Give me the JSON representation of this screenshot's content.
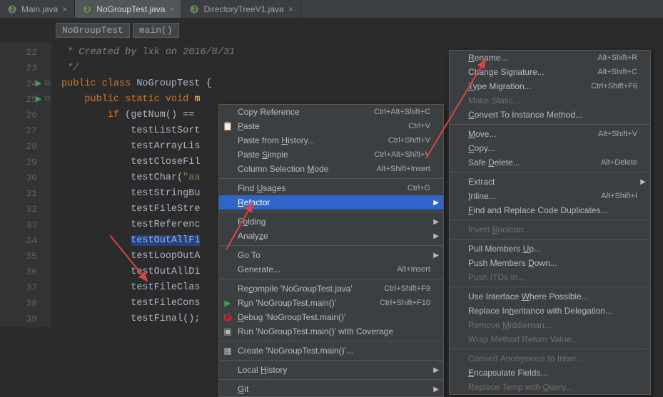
{
  "tabs": [
    {
      "label": "Main.java",
      "active": false
    },
    {
      "label": "NoGroupTest.java",
      "active": true
    },
    {
      "label": "DirectoryTreeV1.java",
      "active": false
    }
  ],
  "breadcrumbs": [
    {
      "label": "NoGroupTest"
    },
    {
      "label": "main()"
    }
  ],
  "lines": [
    {
      "num": 22,
      "run": false
    },
    {
      "num": 23,
      "run": false
    },
    {
      "num": 24,
      "run": true
    },
    {
      "num": 25,
      "run": true
    },
    {
      "num": 26,
      "run": false
    },
    {
      "num": 27,
      "run": false
    },
    {
      "num": 28,
      "run": false
    },
    {
      "num": 29,
      "run": false
    },
    {
      "num": 30,
      "run": false
    },
    {
      "num": 31,
      "run": false
    },
    {
      "num": 32,
      "run": false
    },
    {
      "num": 33,
      "run": false
    },
    {
      "num": 34,
      "run": false
    },
    {
      "num": 35,
      "run": false
    },
    {
      "num": 36,
      "run": false
    },
    {
      "num": 37,
      "run": false
    },
    {
      "num": 38,
      "run": false
    },
    {
      "num": 39,
      "run": false
    }
  ],
  "code": {
    "l22_pre": " * Created by lxk on 2016/8/31",
    "l23_pre": " */",
    "l24_kw1": "public class ",
    "l24_cls": "NoGroupTest ",
    "l24_brace": "{",
    "l25_kw1": "public static void ",
    "l25_mth": "m",
    "l26_kw1": "if ",
    "l26_p": "(",
    "l26_call": "getNum",
    "l26_p2": "() == ",
    "l27": "testListSort",
    "l28": "testArrayLis",
    "l29": "testCloseFil",
    "l30a": "testChar",
    "l30b": "(",
    "l30c": "\"aa",
    "l31": "testStringBu",
    "l32": "testFileStre",
    "l33": "testReferenc",
    "l34": "testOutAllFi",
    "l35": "testLoopOutA",
    "l36": "testOutAllDi",
    "l37": "testFileClas",
    "l38": "testFileCons",
    "l39a": "testFinal",
    "l39b": "();"
  },
  "context_menu": [
    {
      "label": "Copy Reference",
      "shortcut": "Ctrl+Alt+Shift+C"
    },
    {
      "label": "Paste",
      "mnem": "P",
      "shortcut": "Ctrl+V",
      "icon": "paste"
    },
    {
      "label": "Paste from History...",
      "mnem": "H",
      "shortcut": "Ctrl+Shift+V"
    },
    {
      "label": "Paste Simple",
      "mnem": "S",
      "shortcut": "Ctrl+Alt+Shift+V"
    },
    {
      "label": "Column Selection Mode",
      "mnem": "M",
      "shortcut": "Alt+Shift+Insert"
    },
    {
      "sep": true
    },
    {
      "label": "Find Usages",
      "mnem": "U",
      "shortcut": "Ctrl+G"
    },
    {
      "label": "Refactor",
      "mnem": "R",
      "sub": true,
      "hl": true
    },
    {
      "sep": true
    },
    {
      "label": "Folding",
      "mnem": "o",
      "sub": true
    },
    {
      "label": "Analyze",
      "mnem": "z",
      "sub": true
    },
    {
      "sep": true
    },
    {
      "label": "Go To",
      "sub": true
    },
    {
      "label": "Generate...",
      "shortcut": "Alt+Insert"
    },
    {
      "sep": true
    },
    {
      "label": "Recompile 'NoGroupTest.java'",
      "mnem": "c",
      "shortcut": "Ctrl+Shift+F9"
    },
    {
      "label": "Run 'NoGroupTest.main()'",
      "mnem": "u",
      "shortcut": "Ctrl+Shift+F10",
      "icon": "run"
    },
    {
      "label": "Debug 'NoGroupTest.main()'",
      "mnem": "D",
      "icon": "debug"
    },
    {
      "label": "Run 'NoGroupTest.main()' with Coverage",
      "icon": "coverage"
    },
    {
      "sep": true
    },
    {
      "label": "Create 'NoGroupTest.main()'...",
      "icon": "create"
    },
    {
      "sep": true
    },
    {
      "label": "Local History",
      "mnem": "H",
      "sub": true
    },
    {
      "sep": true
    },
    {
      "label": "Git",
      "mnem": "G",
      "sub": true
    }
  ],
  "refactor_menu": [
    {
      "label": "Rename...",
      "mnem": "R",
      "shortcut": "Alt+Shift+R"
    },
    {
      "label": "Change Signature...",
      "mnem": "g",
      "shortcut": "Alt+Shift+C"
    },
    {
      "label": "Type Migration...",
      "mnem": "T",
      "shortcut": "Ctrl+Shift+F6"
    },
    {
      "label": "Make Static...",
      "disabled": true
    },
    {
      "label": "Convert To Instance Method...",
      "mnem": "C"
    },
    {
      "sep": true
    },
    {
      "label": "Move...",
      "mnem": "M",
      "shortcut": "Alt+Shift+V"
    },
    {
      "label": "Copy...",
      "mnem": "C"
    },
    {
      "label": "Safe Delete...",
      "mnem": "D",
      "shortcut": "Alt+Delete"
    },
    {
      "sep": true
    },
    {
      "label": "Extract",
      "sub": true
    },
    {
      "label": "Inline...",
      "mnem": "I",
      "shortcut": "Alt+Shift+I"
    },
    {
      "label": "Find and Replace Code Duplicates...",
      "mnem": "F"
    },
    {
      "sep": true
    },
    {
      "label": "Invert Boolean...",
      "mnem": "B",
      "disabled": true
    },
    {
      "sep": true
    },
    {
      "label": "Pull Members Up...",
      "mnem": "U"
    },
    {
      "label": "Push Members Down...",
      "mnem": "D"
    },
    {
      "label": "Push ITDs In...",
      "disabled": true
    },
    {
      "sep": true
    },
    {
      "label": "Use Interface Where Possible...",
      "mnem": "W"
    },
    {
      "label": "Replace Inheritance with Delegation...",
      "mnem": "h"
    },
    {
      "label": "Remove Middleman...",
      "mnem": "M",
      "disabled": true
    },
    {
      "label": "Wrap Method Return Value...",
      "disabled": true
    },
    {
      "sep": true
    },
    {
      "label": "Convert Anonymous to Inner...",
      "disabled": true
    },
    {
      "label": "Encapsulate Fields...",
      "mnem": "E"
    },
    {
      "label": "Replace Temp with Query...",
      "mnem": "Q",
      "disabled": true
    }
  ]
}
